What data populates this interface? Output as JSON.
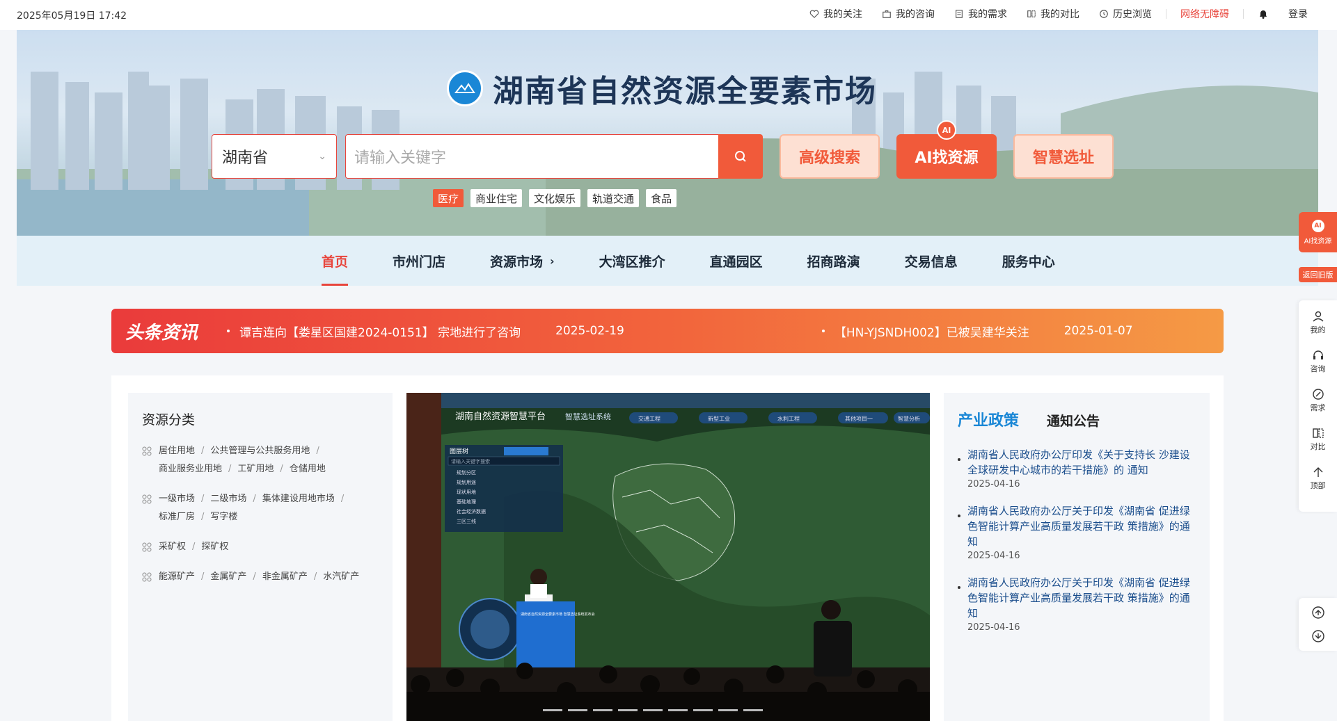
{
  "topbar": {
    "datetime": "2025年05月19日 17:42",
    "links": [
      {
        "label": "我的关注",
        "icon": "heart-icon"
      },
      {
        "label": "我的咨询",
        "icon": "briefcase-icon"
      },
      {
        "label": "我的需求",
        "icon": "document-icon"
      },
      {
        "label": "我的对比",
        "icon": "compare-icon"
      },
      {
        "label": "历史浏览",
        "icon": "clock-icon"
      }
    ],
    "accessibility": "网络无障碍",
    "login": "登录"
  },
  "hero": {
    "title": "湖南省自然资源全要素市场",
    "region": "湖南省",
    "search_placeholder": "请输入关键字",
    "btn_advanced": "高级搜索",
    "btn_ai": "AI找资源",
    "ai_badge": "AI",
    "btn_site": "智慧选址",
    "hot_tags": [
      "医疗",
      "商业住宅",
      "文化娱乐",
      "轨道交通",
      "食品"
    ]
  },
  "nav": {
    "items": [
      "首页",
      "市州门店",
      "资源市场",
      "大湾区推介",
      "直通园区",
      "招商路演",
      "交易信息",
      "服务中心"
    ],
    "active": "首页"
  },
  "ticker": {
    "label": "头条资讯",
    "news": [
      {
        "text": "谭吉连向【娄星区国建2024-0151】 宗地进行了咨询",
        "date": "2025-02-19"
      },
      {
        "text": "【HN-YJSNDH002】已被吴建华关注",
        "date": "2025-01-07"
      }
    ]
  },
  "resources": {
    "title": "资源分类",
    "groups": [
      [
        "居住用地",
        "公共管理与公共服务用地",
        "商业服务业用地",
        "工矿用地",
        "仓储用地"
      ],
      [
        "一级市场",
        "二级市场",
        "集体建设用地市场",
        "标准厂房",
        "写字楼"
      ],
      [
        "采矿权",
        "探矿权"
      ],
      [
        "能源矿产",
        "金属矿产",
        "非金属矿产",
        "水汽矿产"
      ]
    ]
  },
  "carousel": {
    "screen_title": "湖南自然资源智慧平台",
    "screen_subtitle": "智慧选址系统",
    "screen_tab": "图层树",
    "screen_search": "请输入关键字搜索",
    "screen_pills": [
      "交通工程",
      "新型工业",
      "水利工程",
      "其他项目一",
      "智慧分析"
    ],
    "layer_items": [
      "规划分区",
      "规划用途",
      "现状用地",
      "基础地理",
      "社会经济数据",
      "三区三线"
    ],
    "podium_text": "湖南省自然资源全要素市场 智慧选址系统发布会"
  },
  "policy": {
    "tab_active": "产业政策",
    "tab_other": "通知公告",
    "items": [
      {
        "text": "湖南省人民政府办公厅印发《关于支持长 沙建设全球研发中心城市的若干措施》的 通知",
        "date": "2025-04-16"
      },
      {
        "text": "湖南省人民政府办公厅关于印发《湖南省 促进绿色智能计算产业高质量发展若干政 策措施》的通知",
        "date": "2025-04-16"
      },
      {
        "text": "湖南省人民政府办公厅关于印发《湖南省 促进绿色智能计算产业高质量发展若干政 策措施》的通知",
        "date": "2025-04-16"
      }
    ]
  },
  "float": {
    "ai_label": "AI找资源",
    "ai_badge": "AI",
    "back_old": "返回旧版",
    "menu": [
      {
        "label": "我的",
        "icon": "user-icon"
      },
      {
        "label": "咨询",
        "icon": "headset-icon"
      },
      {
        "label": "需求",
        "icon": "link-icon"
      },
      {
        "label": "对比",
        "icon": "compare-icon"
      },
      {
        "label": "顶部",
        "icon": "top-icon"
      }
    ]
  },
  "colors": {
    "accent": "#f15a3a",
    "link": "#1a87d6",
    "nav_bg": "#e3f0f8"
  }
}
